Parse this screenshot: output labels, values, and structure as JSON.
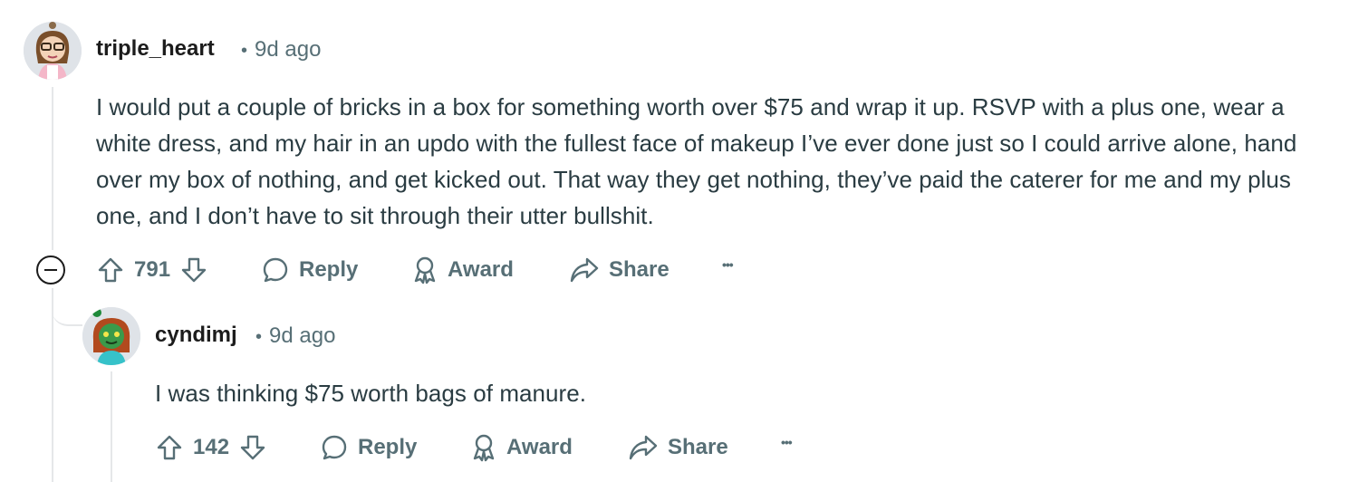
{
  "comments": [
    {
      "author": "triple_heart",
      "time": "9d ago",
      "separator": "•",
      "body": "I would put a couple of bricks in a box for something worth over $75 and wrap it up. RSVP with a plus one, wear a white dress, and my hair in an updo with the fullest face of makeup I’ve ever done just so I could arrive alone, hand over my box of nothing, and get kicked out. That way they get nothing, they’ve paid the caterer for me and my plus one, and I don’t have to sit through their utter bullshit.",
      "score": "791",
      "reply_label": "Reply",
      "award_label": "Award",
      "share_label": "Share",
      "more_label": "•••"
    },
    {
      "author": "cyndimj",
      "time": "9d ago",
      "separator": "•",
      "body": "I was thinking $75 worth bags of manure.",
      "score": "142",
      "reply_label": "Reply",
      "award_label": "Award",
      "share_label": "Share",
      "more_label": "•••"
    }
  ],
  "colors": {
    "text_primary": "#1c1c1c",
    "text_body": "#2a3c42",
    "text_meta": "#576f76",
    "thread_line": "#e5e7e9"
  },
  "icons": [
    "upvote-icon",
    "downvote-icon",
    "reply-icon",
    "award-icon",
    "share-icon",
    "more-options-icon",
    "collapse-icon"
  ]
}
